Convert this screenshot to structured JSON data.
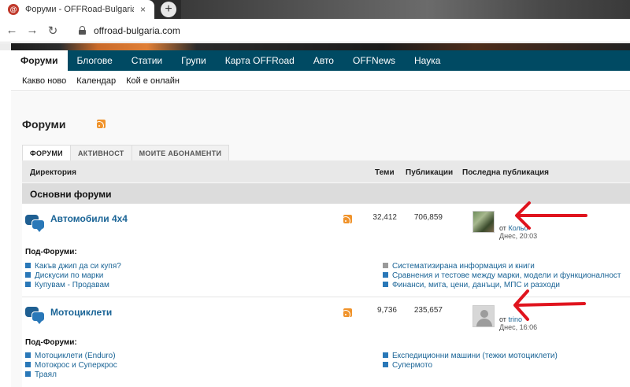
{
  "browser": {
    "tab_title": "Форуми - OFFRoad-Bulgaria.com",
    "tab_favicon": "@",
    "tab_close": "×",
    "new_tab": "+",
    "back": "←",
    "forward": "→",
    "reload": "↻",
    "url": "offroad-bulgaria.com"
  },
  "main_nav": [
    "Форуми",
    "Блогове",
    "Статии",
    "Групи",
    "Карта OFFRoad",
    "Авто",
    "OFFNews",
    "Наука"
  ],
  "sub_nav": [
    "Какво ново",
    "Календар",
    "Кой е онлайн"
  ],
  "page_title": "Форуми",
  "forum_tabs": [
    "ФОРУМИ",
    "АКТИВНОСТ",
    "МОИТЕ АБОНАМЕНТИ"
  ],
  "columns": {
    "directory": "Директория",
    "topics": "Теми",
    "posts": "Публикации",
    "last_post": "Последна публикация"
  },
  "section_title": "Основни форуми",
  "forums": [
    {
      "title": "Автомобили 4x4",
      "topics": "32,412",
      "posts": "706,859",
      "last_post_prefix": "от",
      "last_post_user": "Кольо",
      "last_post_date": "Днес, 20:03",
      "subforums_label": "Под-Форуми:",
      "subforums_left": [
        "Какъв джип да си купя?",
        "Дискусии по марки",
        "Купувам - Продавам"
      ],
      "subforums_right": [
        "Систематизирана информация и книги",
        "Сравнения и тестове между марки, модели и функционалност",
        "Финанси, мита, цени, данъци, МПС и разходи"
      ]
    },
    {
      "title": "Мотоциклети",
      "topics": "9,736",
      "posts": "235,657",
      "last_post_prefix": "от",
      "last_post_user": "trino",
      "last_post_date": "Днес, 16:06",
      "subforums_label": "Под-Форуми:",
      "subforums_left": [
        "Мотоциклети (Enduro)",
        "Мотокрос и Суперкрос",
        "Траял"
      ],
      "subforums_right": [
        "Експедиционни машини (тежки мотоциклети)",
        "Супермото"
      ]
    }
  ],
  "colors": {
    "nav_bg": "#004a63",
    "link": "#1a6496",
    "annotation_arrow": "#e0141e",
    "rss": "#f0932b"
  }
}
